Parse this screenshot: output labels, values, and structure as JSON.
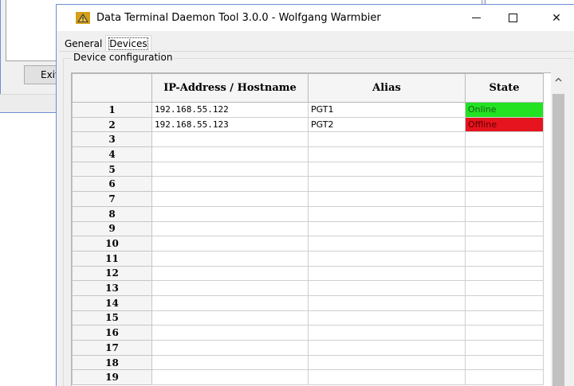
{
  "background_window": {
    "exit_label": "Exit"
  },
  "window": {
    "title": "Data Terminal Daemon Tool  3.0.0 - Wolfgang Warmbier",
    "icon": "warning-triangle-icon",
    "controls": {
      "minimize": "minimize-icon",
      "maximize": "maximize-icon",
      "close": "✕"
    }
  },
  "tabs": [
    {
      "label": "General"
    },
    {
      "label": "Devices",
      "active": true
    }
  ],
  "group": {
    "label": "Device configuration"
  },
  "grid": {
    "columns": [
      "",
      "IP-Address / Hostname",
      "Alias",
      "State"
    ],
    "rows": [
      {
        "n": "1",
        "ip": "192.168.55.122",
        "alias": "PGT1",
        "state": "Online"
      },
      {
        "n": "2",
        "ip": "192.168.55.123",
        "alias": "PGT2",
        "state": "Offline"
      },
      {
        "n": "3",
        "ip": "",
        "alias": "",
        "state": ""
      },
      {
        "n": "4",
        "ip": "",
        "alias": "",
        "state": ""
      },
      {
        "n": "5",
        "ip": "",
        "alias": "",
        "state": ""
      },
      {
        "n": "6",
        "ip": "",
        "alias": "",
        "state": ""
      },
      {
        "n": "7",
        "ip": "",
        "alias": "",
        "state": ""
      },
      {
        "n": "8",
        "ip": "",
        "alias": "",
        "state": ""
      },
      {
        "n": "9",
        "ip": "",
        "alias": "",
        "state": ""
      },
      {
        "n": "10",
        "ip": "",
        "alias": "",
        "state": ""
      },
      {
        "n": "11",
        "ip": "",
        "alias": "",
        "state": ""
      },
      {
        "n": "12",
        "ip": "",
        "alias": "",
        "state": ""
      },
      {
        "n": "13",
        "ip": "",
        "alias": "",
        "state": ""
      },
      {
        "n": "14",
        "ip": "",
        "alias": "",
        "state": ""
      },
      {
        "n": "15",
        "ip": "",
        "alias": "",
        "state": ""
      },
      {
        "n": "16",
        "ip": "",
        "alias": "",
        "state": ""
      },
      {
        "n": "17",
        "ip": "",
        "alias": "",
        "state": ""
      },
      {
        "n": "18",
        "ip": "",
        "alias": "",
        "state": ""
      },
      {
        "n": "19",
        "ip": "",
        "alias": "",
        "state": ""
      }
    ],
    "state_colors": {
      "Online": "#22e222",
      "Offline": "#e6141e"
    }
  },
  "scrollbar": {
    "up_arrow": "chevron-up-icon"
  }
}
